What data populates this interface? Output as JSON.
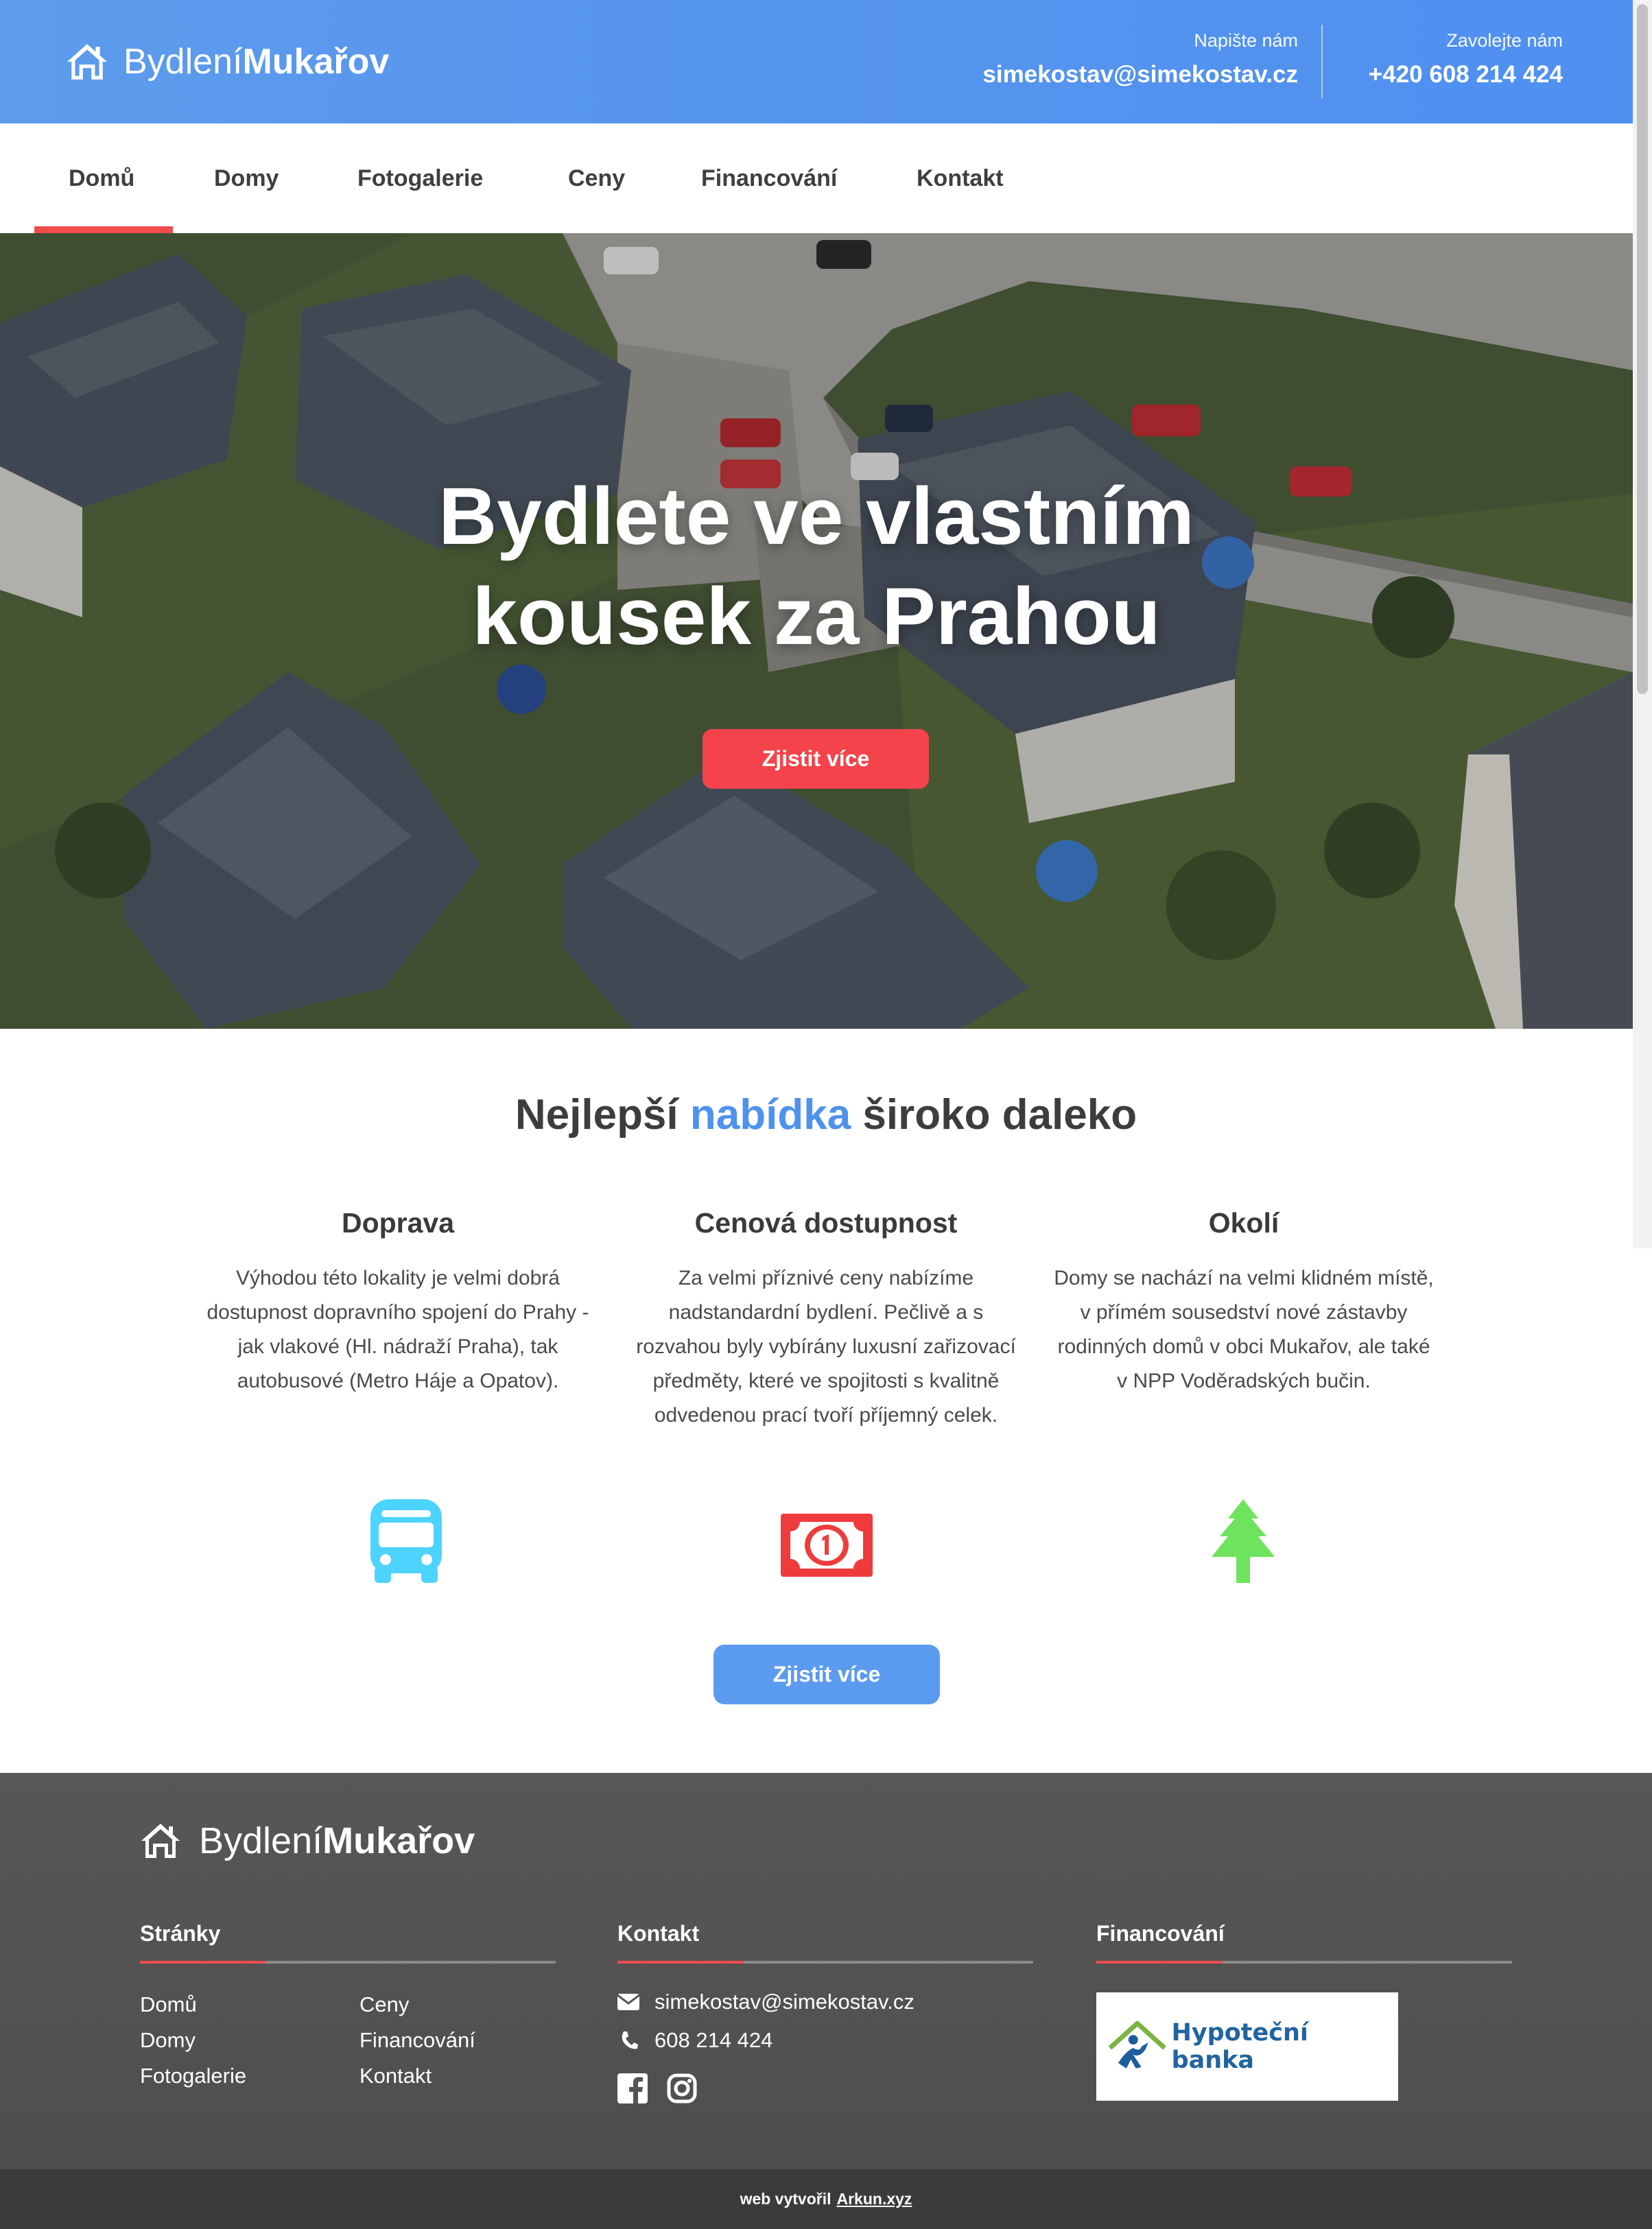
{
  "brand": {
    "name_light": "Bydlení",
    "name_bold": "Mukařov"
  },
  "header": {
    "mail_label": "Napište nám",
    "mail_value": "simekostav@simekostav.cz",
    "phone_label": "Zavolejte nám",
    "phone_value": "+420 608 214 424"
  },
  "nav": {
    "items": [
      {
        "label": "Domů",
        "active": true
      },
      {
        "label": "Domy"
      },
      {
        "label": "Fotogalerie"
      },
      {
        "label": "Ceny"
      },
      {
        "label": "Financování"
      },
      {
        "label": "Kontakt"
      }
    ]
  },
  "hero": {
    "title_line1": "Bydlete ve vlastním",
    "title_line2": "kousek za Prahou",
    "button": "Zjistit více"
  },
  "offer": {
    "title_pre": "Nejlepší",
    "title_accent": "nabídka",
    "title_post": "široko daleko",
    "features": [
      {
        "title": "Doprava",
        "text": "Výhodou této lokality je velmi dobrá dostupnost dopravního spojení do Prahy - jak vlakové (Hl. nádraží Praha), tak autobusové (Metro Háje a Opatov).",
        "icon": "bus-icon"
      },
      {
        "title": "Cenová dostupnost",
        "text": "Za velmi příznivé ceny nabízíme nadstandardní bydlení. Pečlivě a s rozvahou byly vybírány luxusní zařizovací předměty, které ve spojitosti s kvalitně odvedenou prací tvoří příjemný celek.",
        "icon": "money-icon"
      },
      {
        "title": "Okolí",
        "text": "Domy se nachází na velmi klidném místě, v přímém sousedství nové zástavby rodinných domů v obci Mukařov, ale také v NPP Voděradských bučin.",
        "icon": "tree-icon"
      }
    ],
    "button": "Zjistit více"
  },
  "footer": {
    "pages_title": "Stránky",
    "pages_col1": [
      "Domů",
      "Domy",
      "Fotogalerie"
    ],
    "pages_col2": [
      "Ceny",
      "Financování",
      "Kontakt"
    ],
    "contact_title": "Kontakt",
    "email": "simekostav@simekostav.cz",
    "phone": "608 214 424",
    "financing_title": "Financování",
    "bank_name": "Hypoteční banka",
    "credit_pre": "web vytvořil",
    "credit_link": "Arkun.xyz"
  },
  "colors": {
    "header_blue": "#5d9bec",
    "accent_red": "#f5434b",
    "accent_blue": "#4f92ee",
    "bus_cyan": "#4dd3ff",
    "money_red": "#ef3b3b",
    "tree_green": "#6ee35d",
    "footer_gray": "#555555"
  }
}
